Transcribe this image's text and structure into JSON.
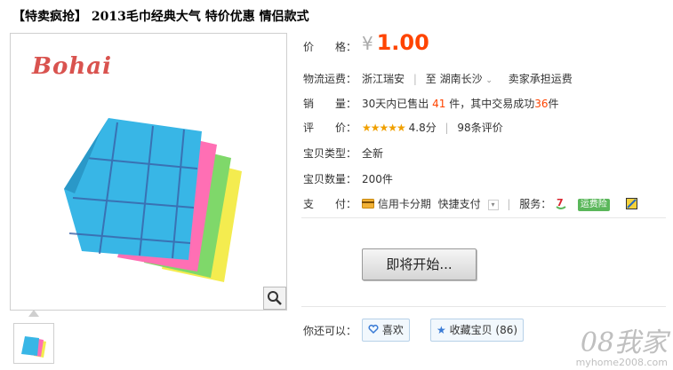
{
  "product": {
    "title": "【特卖疯抢】 2013毛巾经典大气 特价优惠 情侣款式",
    "brand_logo": "Bohai"
  },
  "details": {
    "price_label": "价　　格：",
    "currency": "¥",
    "price": "1.00",
    "shipping_label": "物流运费：",
    "shipping_from": "浙江瑞安",
    "shipping_to_prefix": "至",
    "shipping_to": "湖南长沙",
    "shipping_note": "卖家承担运费",
    "sales_label": "销　　量：",
    "sales_prefix": "30天内已售出",
    "sales_count": "41",
    "sales_mid": "件，其中交易成功",
    "sales_success": "36",
    "sales_suffix": "件",
    "rating_label": "评　　价：",
    "rating_stars": "★★★★★",
    "rating_score": "4.8分",
    "rating_reviews": "98条评价",
    "type_label": "宝贝类型：",
    "type_value": "全新",
    "qty_label": "宝贝数量：",
    "qty_value": "200件",
    "pay_label": "支　　付：",
    "pay_credit": "信用卡分期",
    "pay_quick": "快捷支付",
    "service_label": "服务：",
    "service_badge": "运费险"
  },
  "actions": {
    "start_button": "即将开始...",
    "you_can_label": "你还可以：",
    "like_button": "喜欢",
    "favorite_button": "收藏宝贝 (86)"
  },
  "watermark": {
    "big": "08我家",
    "small": "myhome2008.com"
  },
  "colors": {
    "price": "#ff4400",
    "accent_green": "#5bb75b"
  }
}
